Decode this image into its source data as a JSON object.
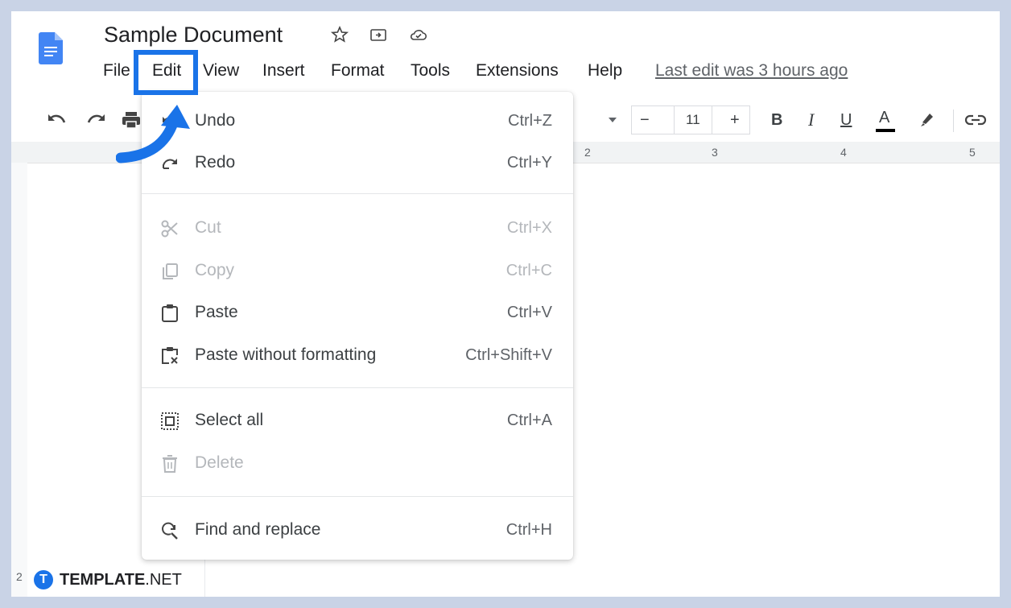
{
  "document": {
    "title": "Sample Document",
    "last_edit": "Last edit was 3 hours ago"
  },
  "menubar": {
    "items": [
      "File",
      "Edit",
      "View",
      "Insert",
      "Format",
      "Tools",
      "Extensions",
      "Help"
    ],
    "active": "Edit"
  },
  "toolbar": {
    "font_size": "11",
    "minus": "−",
    "plus": "+",
    "bold": "B",
    "italic": "I",
    "underline": "U",
    "text_color": "A"
  },
  "ruler": {
    "numbers": [
      "2",
      "3",
      "4",
      "5"
    ],
    "side_number": "2"
  },
  "edit_menu": {
    "items": [
      {
        "label": "Undo",
        "shortcut": "Ctrl+Z",
        "icon": "undo-icon",
        "enabled": true
      },
      {
        "label": "Redo",
        "shortcut": "Ctrl+Y",
        "icon": "redo-icon",
        "enabled": true
      },
      {
        "label": "Cut",
        "shortcut": "Ctrl+X",
        "icon": "cut-icon",
        "enabled": false
      },
      {
        "label": "Copy",
        "shortcut": "Ctrl+C",
        "icon": "copy-icon",
        "enabled": false
      },
      {
        "label": "Paste",
        "shortcut": "Ctrl+V",
        "icon": "paste-icon",
        "enabled": true
      },
      {
        "label": "Paste without formatting",
        "shortcut": "Ctrl+Shift+V",
        "icon": "paste-plain-icon",
        "enabled": true
      },
      {
        "label": "Select all",
        "shortcut": "Ctrl+A",
        "icon": "select-all-icon",
        "enabled": true
      },
      {
        "label": "Delete",
        "shortcut": "",
        "icon": "delete-icon",
        "enabled": false
      },
      {
        "label": "Find and replace",
        "shortcut": "Ctrl+H",
        "icon": "find-replace-icon",
        "enabled": true
      }
    ]
  },
  "watermark": {
    "logo_letter": "T",
    "brand": "TEMPLATE",
    "suffix": ".NET"
  },
  "colors": {
    "accent": "#1a73e8",
    "background": "#c9d3e6",
    "disabled_text": "#b4b7bb"
  }
}
